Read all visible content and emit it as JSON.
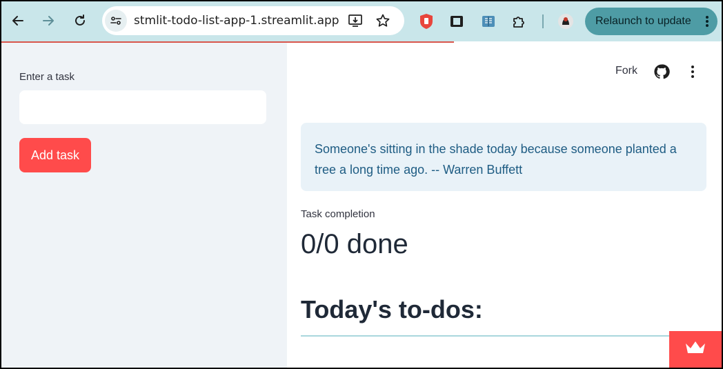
{
  "browser": {
    "url": "stmlit-todo-list-app-1.streamlit.app",
    "relaunch_label": "Relaunch to update"
  },
  "header": {
    "fork_label": "Fork"
  },
  "sidebar": {
    "input_label": "Enter a task",
    "input_value": "",
    "button_label": "Add task"
  },
  "main": {
    "quote": "Someone's sitting in the shade today because someone planted a tree a long time ago. -- Warren Buffett",
    "metric_label": "Task completion",
    "metric_value": "0/0 done",
    "heading": "Today's to-dos:"
  },
  "icons": {
    "back": "back-arrow-icon",
    "forward": "forward-arrow-icon",
    "reload": "reload-icon",
    "site_info": "site-settings-icon",
    "install": "install-app-icon",
    "bookmark": "star-icon",
    "github": "github-icon",
    "menu": "more-vertical-icon",
    "badge": "crown-icon"
  },
  "colors": {
    "accent": "#ff4b4b",
    "sidebar_bg": "#eff3f7",
    "info_bg": "#e9f2f8",
    "info_text": "#1e5c83",
    "toolbar_bg": "#c9e6ea"
  }
}
